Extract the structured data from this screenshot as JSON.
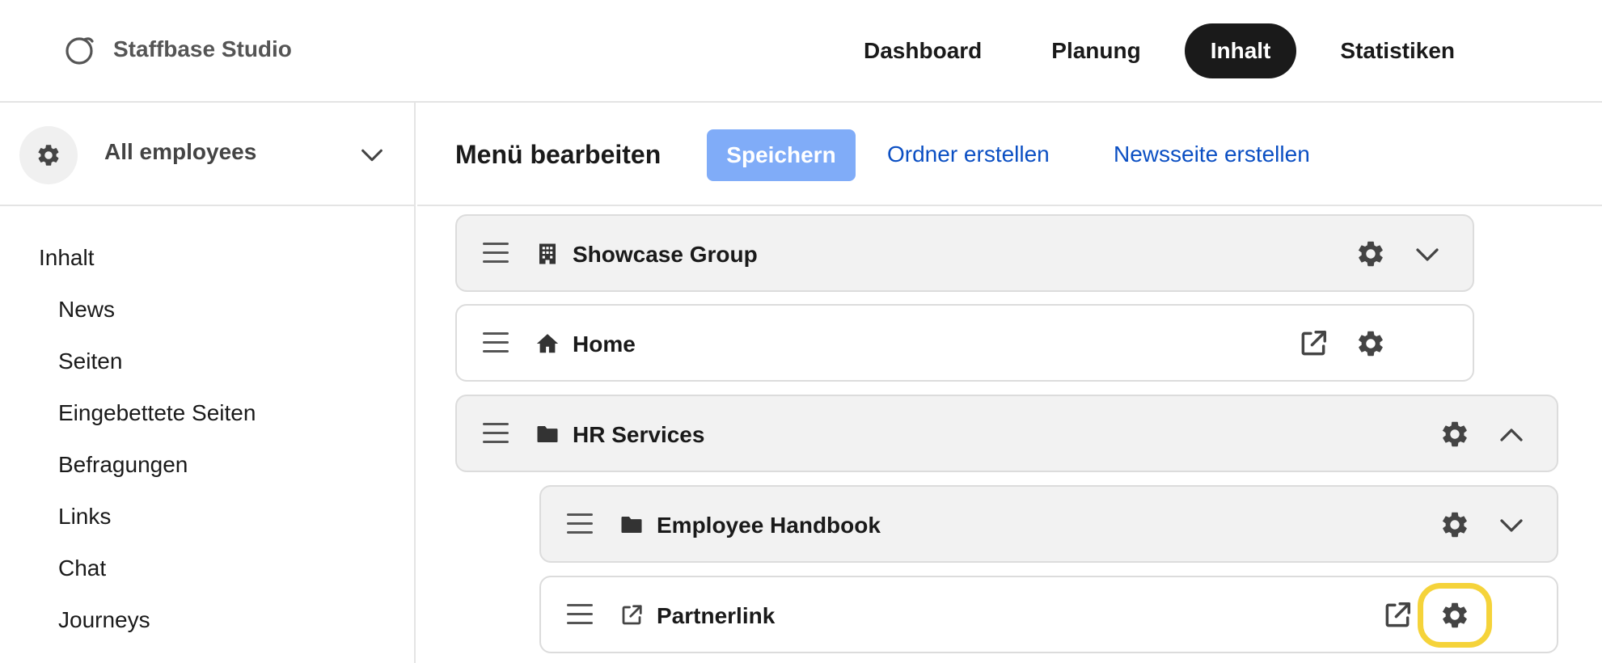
{
  "app": {
    "name": "Staffbase Studio"
  },
  "topnav": [
    "Dashboard",
    "Planung",
    "Inhalt",
    "Statistiken"
  ],
  "topnav_active": "Inhalt",
  "sidebar": {
    "scope_label": "All employees",
    "heading": "Inhalt",
    "items": [
      "News",
      "Seiten",
      "Eingebettete Seiten",
      "Befragungen",
      "Links",
      "Chat",
      "Journeys"
    ]
  },
  "main": {
    "title": "Menü bearbeiten",
    "save_label": "Speichern",
    "create_folder_label": "Ordner erstellen",
    "create_newspage_label": "Newsseite erstellen"
  },
  "menu_items": [
    {
      "label": "Showcase Group",
      "icon": "building-icon",
      "expanded": false
    },
    {
      "label": "Home",
      "icon": "home-icon",
      "external_link": true
    },
    {
      "label": "HR Services",
      "icon": "folder-icon",
      "expanded": true
    },
    {
      "label": "Employee Handbook",
      "icon": "folder-icon",
      "expanded": false
    },
    {
      "label": "Partnerlink",
      "icon": "external-link-icon",
      "external_link": true,
      "settings_highlighted": true
    }
  ],
  "colors": {
    "accent_button": "#80acf8",
    "link": "#0b4fc3",
    "active_nav": "#1a1a1a",
    "highlight": "#f5d33a"
  }
}
